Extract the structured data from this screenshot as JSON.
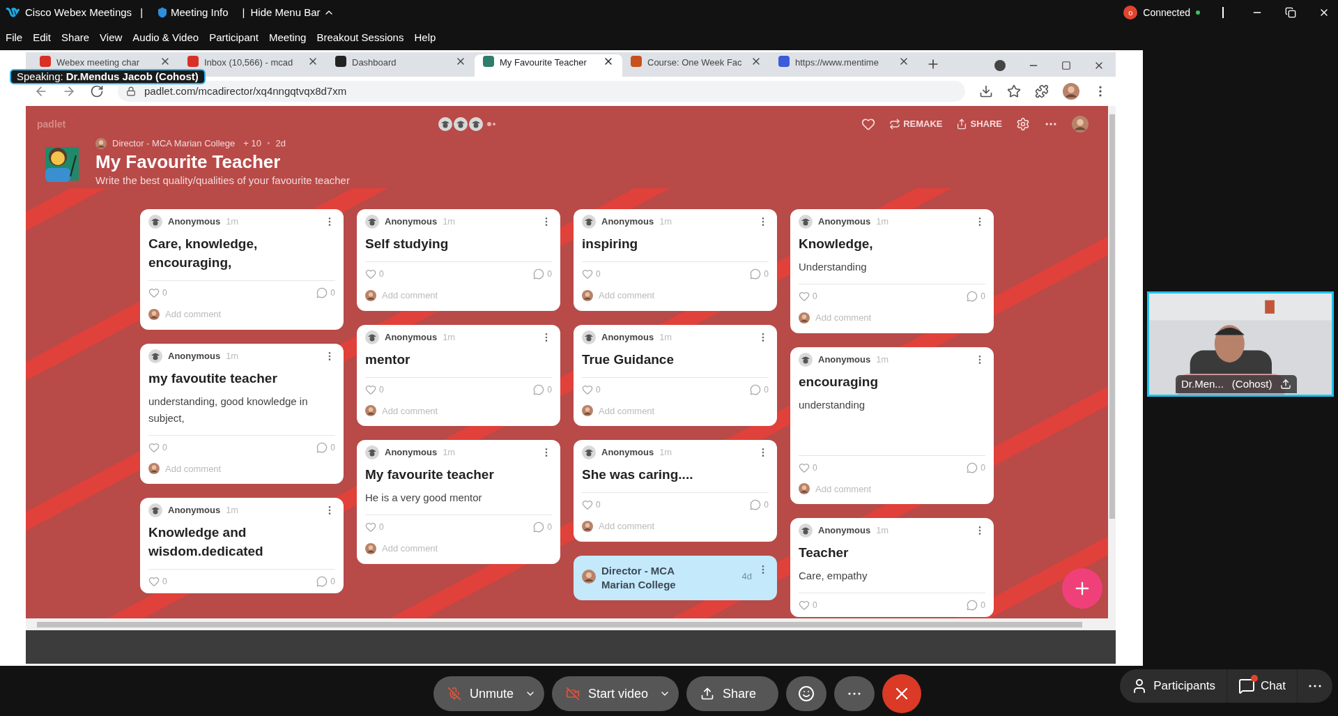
{
  "app_bar": {
    "app_name": "Cisco Webex Meetings",
    "separator_1": "|",
    "meeting_info": "Meeting Info",
    "separator_2": "|",
    "hide_menu": "Hide Menu Bar",
    "status": "Connected",
    "recording_badge": "o"
  },
  "menu": [
    "File",
    "Edit",
    "Share",
    "View",
    "Audio & Video",
    "Participant",
    "Meeting",
    "Breakout Sessions",
    "Help"
  ],
  "speaking": {
    "label": "Speaking:",
    "name": "Dr.Mendus Jacob (Cohost)"
  },
  "browser": {
    "tabs": [
      {
        "title": "Webex meeting char",
        "selected": false,
        "color": "#d93025"
      },
      {
        "title": "Inbox (10,566) - mcad",
        "selected": false,
        "color": "#d93025"
      },
      {
        "title": "Dashboard",
        "selected": false,
        "color": "#222222"
      },
      {
        "title": "My Favourite Teacher",
        "selected": true,
        "color": "#2e7d6a"
      },
      {
        "title": "Course: One Week Fac",
        "selected": false,
        "color": "#c8501e"
      },
      {
        "title": "https://www.mentime",
        "selected": false,
        "color": "#3b5bdb"
      }
    ],
    "url": "padlet.com/mcadirector/xq4nngqtvqx8d7xm"
  },
  "padlet": {
    "logo": "padlet",
    "actions": [
      "REMAKE",
      "SHARE"
    ],
    "owner": "Director - MCA Marian College",
    "contributors": "+ 10",
    "dot": "•",
    "age": "2d",
    "title": "My Favourite Teacher",
    "subtitle": "Write the best quality/qualities of your favourite teacher",
    "columns": [
      [
        {
          "kind": "post",
          "author": "Anonymous",
          "time": "1m",
          "title": "Care, knowledge, encouraging,",
          "likes": "0",
          "comments": "0",
          "add_comment": "Add comment"
        },
        {
          "kind": "post",
          "author": "Anonymous",
          "time": "1m",
          "title": "my favoutite teacher",
          "body": "understanding, good knowledge in subject,",
          "likes": "0",
          "comments": "0",
          "add_comment": "Add comment"
        },
        {
          "kind": "post",
          "author": "Anonymous",
          "time": "1m",
          "title": "Knowledge and wisdom.dedicated",
          "likes": "0",
          "comments": "0"
        }
      ],
      [
        {
          "kind": "post",
          "author": "Anonymous",
          "time": "1m",
          "title": "Self studying",
          "likes": "0",
          "comments": "0",
          "add_comment": "Add comment"
        },
        {
          "kind": "post",
          "author": "Anonymous",
          "time": "1m",
          "title": "mentor",
          "likes": "0",
          "comments": "0",
          "add_comment": "Add comment"
        },
        {
          "kind": "post",
          "author": "Anonymous",
          "time": "1m",
          "title": "My favourite teacher",
          "body": "He is a very good mentor",
          "likes": "0",
          "comments": "0",
          "add_comment": "Add comment"
        }
      ],
      [
        {
          "kind": "post",
          "author": "Anonymous",
          "time": "1m",
          "title": "inspiring",
          "likes": "0",
          "comments": "0",
          "add_comment": "Add comment"
        },
        {
          "kind": "post",
          "author": "Anonymous",
          "time": "1m",
          "title": "True Guidance",
          "likes": "0",
          "comments": "0",
          "add_comment": "Add comment"
        },
        {
          "kind": "post",
          "author": "Anonymous",
          "time": "1m",
          "title": "She was caring....",
          "likes": "0",
          "comments": "0",
          "add_comment": "Add comment"
        },
        {
          "kind": "owner",
          "author": "Director - MCA Marian College",
          "time": "4d"
        }
      ],
      [
        {
          "kind": "post",
          "author": "Anonymous",
          "time": "1m",
          "title": "Knowledge,",
          "body": "Understanding",
          "likes": "0",
          "comments": "0",
          "add_comment": "Add comment"
        },
        {
          "kind": "post",
          "author": "Anonymous",
          "time": "1m",
          "title": "encouraging",
          "body": "understanding",
          "likes": "0",
          "comments": "0",
          "add_comment": "Add comment",
          "tall": true
        },
        {
          "kind": "post",
          "author": "Anonymous",
          "time": "1m",
          "title": "Teacher",
          "body": "Care, empathy",
          "likes": "0",
          "comments": "0"
        }
      ]
    ]
  },
  "video_tile": {
    "name": "Dr.Men...",
    "role": "(Cohost)"
  },
  "controls": [
    {
      "kind": "mic",
      "label": "Unmute",
      "menu": true
    },
    {
      "kind": "video",
      "label": "Start video",
      "menu": true
    },
    {
      "kind": "share",
      "label": "Share",
      "menu": false
    },
    {
      "kind": "reactions"
    },
    {
      "kind": "more"
    },
    {
      "kind": "end"
    }
  ],
  "side_controls": [
    {
      "kind": "participants",
      "label": "Participants",
      "alert": false
    },
    {
      "kind": "chat",
      "label": "Chat",
      "alert": true
    },
    {
      "kind": "more"
    }
  ]
}
